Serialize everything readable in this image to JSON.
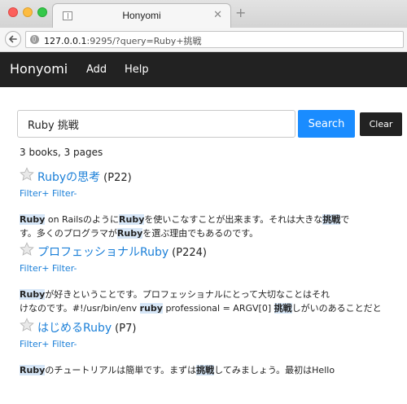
{
  "browser": {
    "tab_title": "Honyomi",
    "tab_close": "✕",
    "new_tab": "+",
    "url_host": "127.0.0.1",
    "url_rest": ":9295/?query=Ruby+挑戦"
  },
  "navbar": {
    "brand": "Honyomi",
    "links": [
      "Add",
      "Help"
    ]
  },
  "search": {
    "value": "Ruby 挑戦",
    "button_label": "Search",
    "clear_label": "Clear"
  },
  "summary": "3 books, 3 pages",
  "colors": {
    "navbar_bg": "#222222",
    "search_button": "#1a8cff",
    "link": "#1a7fd8",
    "highlight": "#d6e6f7"
  },
  "results": [
    {
      "title": "Rubyの思考",
      "page": "(P22)",
      "filter_plus": "Filter+",
      "filter_minus": "Filter-",
      "snippet": [
        {
          "t": "Ruby",
          "hl": true
        },
        {
          "t": " on Railsのように",
          "hl": false
        },
        {
          "t": "Ruby",
          "hl": true
        },
        {
          "t": "を使いこなすことが出来ます。それは大きな",
          "hl": false
        },
        {
          "t": "挑戦",
          "hl": true
        },
        {
          "t": "で\nす。多くのプログラマが",
          "hl": false
        },
        {
          "t": "Ruby",
          "hl": true
        },
        {
          "t": "を選ぶ理由でもあるのです。",
          "hl": false
        }
      ]
    },
    {
      "title": "プロフェッショナルRuby",
      "page": "(P224)",
      "filter_plus": "Filter+",
      "filter_minus": "Filter-",
      "snippet": [
        {
          "t": "Ruby",
          "hl": true
        },
        {
          "t": "が好きということです。プロフェッショナルにとって大切なことはそれ\nけなのです。#!/usr/bin/env ",
          "hl": false
        },
        {
          "t": "ruby",
          "hl": true
        },
        {
          "t": " professional = ARGV[0] ",
          "hl": false
        },
        {
          "t": "挑戦",
          "hl": true
        },
        {
          "t": "しがいのあることだと",
          "hl": false
        }
      ]
    },
    {
      "title": "はじめるRuby",
      "page": "(P7)",
      "filter_plus": "Filter+",
      "filter_minus": "Filter-",
      "snippet": [
        {
          "t": "Ruby",
          "hl": true
        },
        {
          "t": "のチュートリアルは簡単です。まずは",
          "hl": false
        },
        {
          "t": "挑戦",
          "hl": true
        },
        {
          "t": "してみましょう。最初はHello",
          "hl": false
        }
      ]
    }
  ]
}
